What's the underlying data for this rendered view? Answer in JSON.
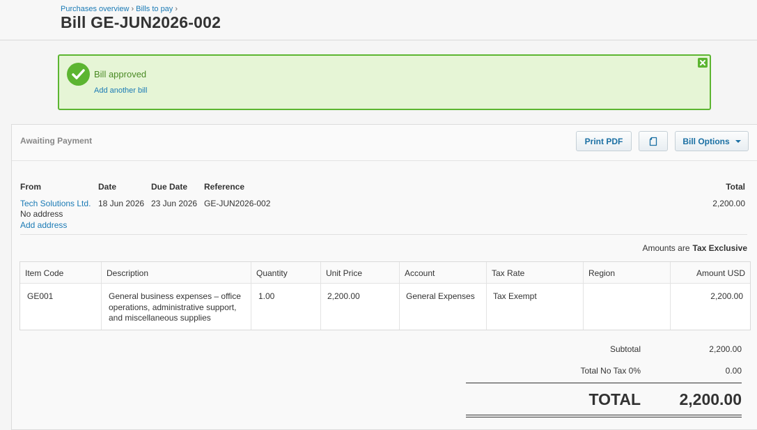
{
  "breadcrumb": {
    "items": [
      "Purchases overview",
      "Bills to pay"
    ],
    "separator": "›"
  },
  "page_title": "Bill GE-JUN2026-002",
  "alert": {
    "message": "Bill approved",
    "link": "Add another bill",
    "icons": [
      "check-circle-icon",
      "close-icon"
    ]
  },
  "bill": {
    "status": "Awaiting Payment",
    "buttons": {
      "print_pdf": "Print PDF",
      "copy_icon": "copy-icon",
      "options": "Bill Options"
    },
    "header_labels": {
      "from": "From",
      "date": "Date",
      "due_date": "Due Date",
      "reference": "Reference",
      "total": "Total"
    },
    "from_name": "Tech Solutions Ltd.",
    "from_address": "No address",
    "add_address": "Add address",
    "date": "18 Jun 2026",
    "due_date": "23 Jun 2026",
    "reference": "GE-JUN2026-002",
    "total": "2,200.00",
    "amounts_are_label": "Amounts are",
    "amounts_are_value": "Tax Exclusive"
  },
  "line_items": {
    "columns": [
      "Item Code",
      "Description",
      "Quantity",
      "Unit Price",
      "Account",
      "Tax Rate",
      "Region",
      "Amount USD"
    ],
    "rows": [
      {
        "item_code": "GE001",
        "description": "General business expenses – office operations, administrative support, and miscellaneous supplies",
        "quantity": "1.00",
        "unit_price": "2,200.00",
        "account": "General Expenses",
        "tax_rate": "Tax Exempt",
        "region": "",
        "amount": "2,200.00"
      }
    ]
  },
  "summary": {
    "subtotal_label": "Subtotal",
    "subtotal": "2,200.00",
    "tax_label": "Total No Tax 0%",
    "tax": "0.00",
    "total_label": "TOTAL",
    "total": "2,200.00"
  },
  "colors": {
    "link": "#1a7ab5",
    "success": "#5cb531",
    "success_bg": "#e6f5d6"
  }
}
